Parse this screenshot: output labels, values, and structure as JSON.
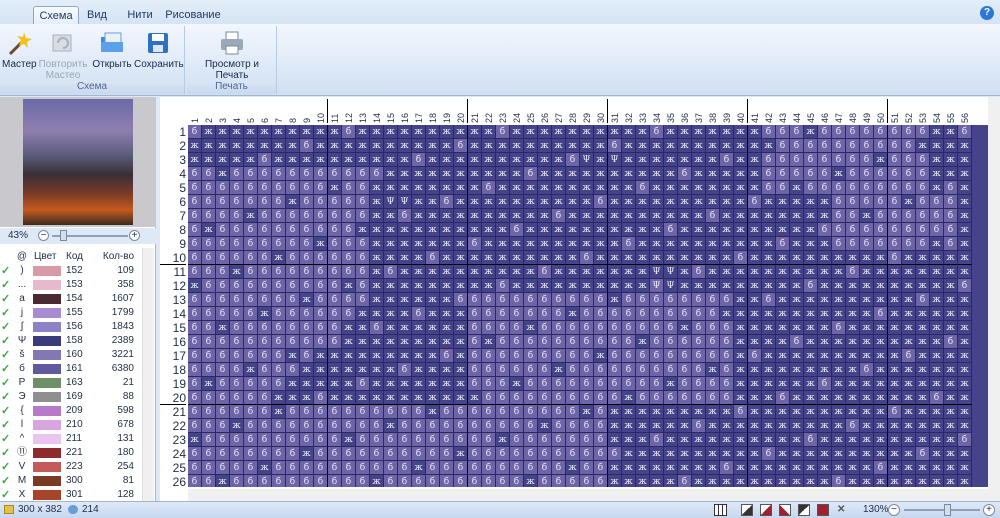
{
  "tabs": [
    "Схема",
    "Вид",
    "Нити",
    "Рисование"
  ],
  "ribbon": {
    "scheme_buttons": [
      "Мастер",
      "Повторить Мастео",
      "Открыть",
      "Сохранить"
    ],
    "scheme_group": "Схема",
    "print_button": "Просмотр и Печать",
    "print_group": "Печать"
  },
  "preview": {
    "zoom": "43%"
  },
  "legend": {
    "headers": {
      "symbol": "@",
      "color": "Цвет",
      "code": "Код",
      "count": "Кол-во"
    },
    "rows": [
      {
        "sym": ")",
        "color": "#d89aa6",
        "code": "152",
        "count": "109"
      },
      {
        "sym": "...",
        "color": "#e8b9cc",
        "code": "153",
        "count": "358"
      },
      {
        "sym": "a",
        "color": "#4a2a2e",
        "code": "154",
        "count": "1607"
      },
      {
        "sym": "j",
        "color": "#a88bd0",
        "code": "155",
        "count": "1799"
      },
      {
        "sym": "∫",
        "color": "#8d82c7",
        "code": "156",
        "count": "1843"
      },
      {
        "sym": "Ψ",
        "color": "#3b3a7a",
        "code": "158",
        "count": "2389"
      },
      {
        "sym": "š",
        "color": "#8378b4",
        "code": "160",
        "count": "3221"
      },
      {
        "sym": "б",
        "color": "#5f5aa0",
        "code": "161",
        "count": "6380"
      },
      {
        "sym": "P",
        "color": "#6d8f6a",
        "code": "163",
        "count": "21"
      },
      {
        "sym": "Э",
        "color": "#8f8f8f",
        "code": "169",
        "count": "88"
      },
      {
        "sym": "{",
        "color": "#b87ac8",
        "code": "209",
        "count": "598"
      },
      {
        "sym": "l",
        "color": "#d9a5e0",
        "code": "210",
        "count": "678"
      },
      {
        "sym": "^",
        "color": "#eac3ee",
        "code": "211",
        "count": "131"
      },
      {
        "sym": "⑪",
        "color": "#8c2a2e",
        "code": "221",
        "count": "180"
      },
      {
        "sym": "V",
        "color": "#c45a5a",
        "code": "223",
        "count": "254"
      },
      {
        "sym": "M",
        "color": "#7a3a24",
        "code": "300",
        "count": "81"
      },
      {
        "sym": "X",
        "color": "#a8442a",
        "code": "301",
        "count": "128"
      }
    ]
  },
  "status": {
    "size": "300 x 382",
    "colors": "214",
    "zoom": "130%"
  },
  "colors": {
    "grid_bg": "#45438a",
    "light_cell": "#6e64a8",
    "accent": "#2d78d6"
  },
  "grid": {
    "rows": [
      "1",
      "2",
      "3",
      "4",
      "5",
      "6",
      "7",
      "8",
      "9",
      "10",
      "11",
      "12",
      "13",
      "14",
      "15",
      "16",
      "17",
      "18",
      "19",
      "20",
      "21",
      "22",
      "23",
      "24",
      "25",
      "26"
    ],
    "cols": [
      "1",
      "2",
      "3",
      "4",
      "5",
      "6",
      "7",
      "8",
      "9",
      "10",
      "11",
      "12",
      "13",
      "14",
      "15",
      "16",
      "17",
      "18",
      "19",
      "20",
      "21",
      "22",
      "23",
      "24",
      "25",
      "26",
      "27",
      "28",
      "29",
      "30",
      "31",
      "32",
      "33",
      "34",
      "35",
      "36",
      "37",
      "38",
      "39",
      "40",
      "41",
      "42",
      "43",
      "44",
      "45",
      "46",
      "47",
      "48",
      "49",
      "50",
      "51",
      "52",
      "53",
      "54",
      "55",
      "56"
    ],
    "symbols": {
      "dark": "ж",
      "light": "б",
      "special": "Ψ"
    }
  }
}
